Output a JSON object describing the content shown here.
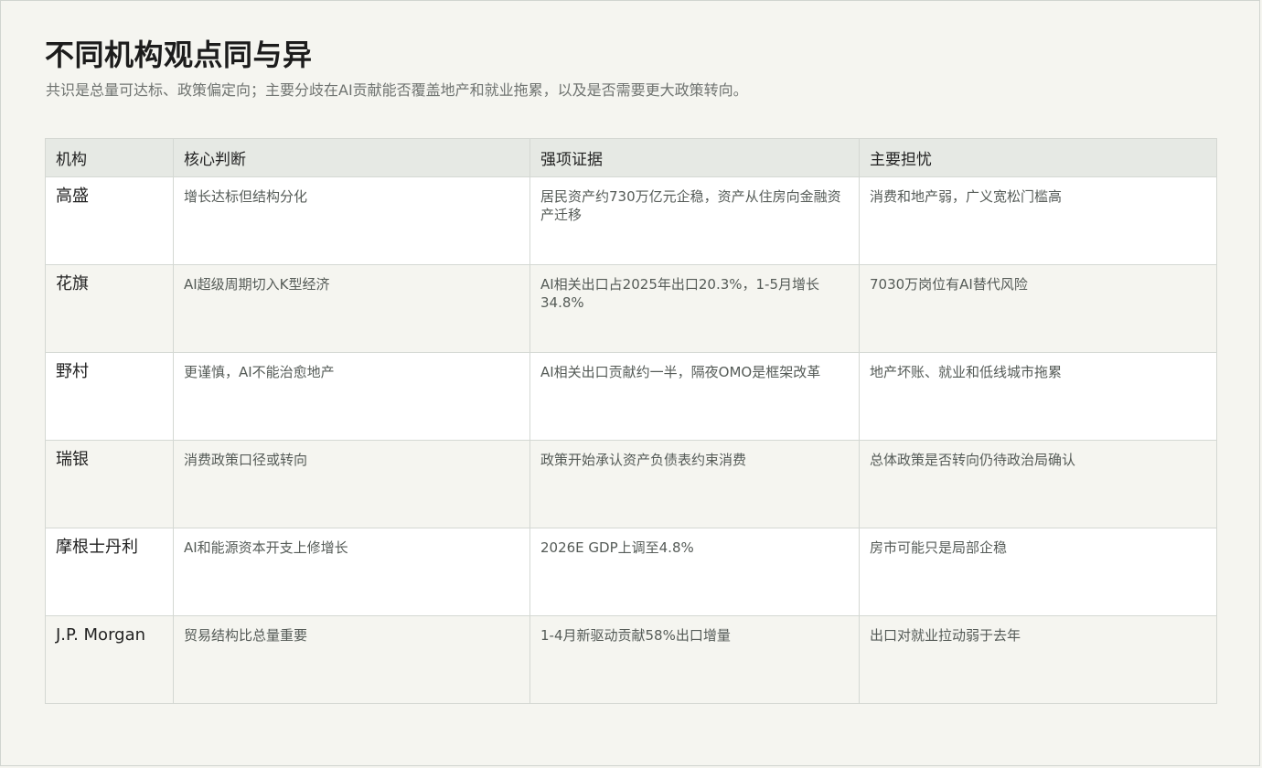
{
  "title": "不同机构观点同与异",
  "subtitle": "共识是总量可达标、政策偏定向；主要分歧在AI贡献能否覆盖地产和就业拖累，以及是否需要更大政策转向。",
  "table": {
    "headers": [
      "机构",
      "核心判断",
      "强项证据",
      "主要担忧"
    ],
    "rows": [
      [
        "高盛",
        "增长达标但结构分化",
        "居民资产约730万亿元企稳，资产从住房向金融资产迁移",
        "消费和地产弱，广义宽松门槛高"
      ],
      [
        "花旗",
        "AI超级周期切入K型经济",
        "AI相关出口占2025年出口20.3%，1-5月增长34.8%",
        "7030万岗位有AI替代风险"
      ],
      [
        "野村",
        "更谨慎，AI不能治愈地产",
        "AI相关出口贡献约一半，隔夜OMO是框架改革",
        "地产坏账、就业和低线城市拖累"
      ],
      [
        "瑞银",
        "消费政策口径或转向",
        "政策开始承认资产负债表约束消费",
        "总体政策是否转向仍待政治局确认"
      ],
      [
        "摩根士丹利",
        "AI和能源资本开支上修增长",
        "2026E GDP上调至4.8%",
        "房市可能只是局部企稳"
      ],
      [
        "J.P. Morgan",
        "贸易结构比总量重要",
        "1-4月新驱动贡献58%出口增量",
        "出口对就业拉动弱于去年"
      ]
    ]
  }
}
